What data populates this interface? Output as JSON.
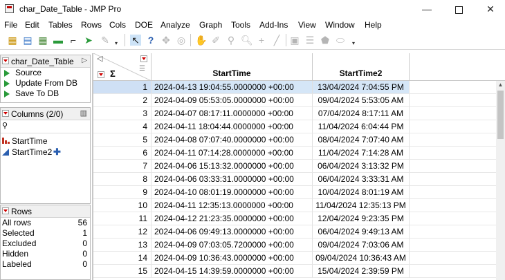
{
  "window": {
    "title": "char_Date_Table - JMP Pro",
    "minimize": "—",
    "close": "✕"
  },
  "menu": [
    "File",
    "Edit",
    "Tables",
    "Rows",
    "Cols",
    "DOE",
    "Analyze",
    "Graph",
    "Tools",
    "Add-Ins",
    "View",
    "Window",
    "Help"
  ],
  "table_panel": {
    "title": "char_Date_Table",
    "scripts": [
      "Source",
      "Update From DB",
      "Save To DB"
    ]
  },
  "columns_panel": {
    "title": "Columns (2/0)",
    "search_icon": "search-icon",
    "columns": [
      {
        "name": "StartTime",
        "icon": "continuous-bar-icon"
      },
      {
        "name": "StartTime2",
        "icon": "ordinal-triangle-icon"
      }
    ]
  },
  "rows_panel": {
    "title": "Rows",
    "stats": [
      {
        "label": "All rows",
        "value": "56"
      },
      {
        "label": "Selected",
        "value": "1"
      },
      {
        "label": "Excluded",
        "value": "0"
      },
      {
        "label": "Hidden",
        "value": "0"
      },
      {
        "label": "Labeled",
        "value": "0"
      }
    ]
  },
  "table": {
    "sigma": "Σ",
    "headers": [
      "StartTime",
      "StartTime2"
    ],
    "selected_row": 1,
    "rows": [
      {
        "n": "1",
        "a": "2024-04-13 19:04:55.0000000 +00:00",
        "b": "13/04/2024 7:04:55 PM"
      },
      {
        "n": "2",
        "a": "2024-04-09 05:53:05.0000000 +00:00",
        "b": "09/04/2024 5:53:05 AM"
      },
      {
        "n": "3",
        "a": "2024-04-07 08:17:11.0000000 +00:00",
        "b": "07/04/2024 8:17:11 AM"
      },
      {
        "n": "4",
        "a": "2024-04-11 18:04:44.0000000 +00:00",
        "b": "11/04/2024 6:04:44 PM"
      },
      {
        "n": "5",
        "a": "2024-04-08 07:07:40.0000000 +00:00",
        "b": "08/04/2024 7:07:40 AM"
      },
      {
        "n": "6",
        "a": "2024-04-11 07:14:28.0000000 +00:00",
        "b": "11/04/2024 7:14:28 AM"
      },
      {
        "n": "7",
        "a": "2024-04-06 15:13:32.0000000 +00:00",
        "b": "06/04/2024 3:13:32 PM"
      },
      {
        "n": "8",
        "a": "2024-04-06 03:33:31.0000000 +00:00",
        "b": "06/04/2024 3:33:31 AM"
      },
      {
        "n": "9",
        "a": "2024-04-10 08:01:19.0000000 +00:00",
        "b": "10/04/2024 8:01:19 AM"
      },
      {
        "n": "10",
        "a": "2024-04-11 12:35:13.0000000 +00:00",
        "b": "11/04/2024 12:35:13 PM"
      },
      {
        "n": "11",
        "a": "2024-04-12 21:23:35.0000000 +00:00",
        "b": "12/04/2024 9:23:35 PM"
      },
      {
        "n": "12",
        "a": "2024-04-06 09:49:13.0000000 +00:00",
        "b": "06/04/2024 9:49:13 AM"
      },
      {
        "n": "13",
        "a": "2024-04-09 07:03:05.7200000 +00:00",
        "b": "09/04/2024 7:03:06 AM"
      },
      {
        "n": "14",
        "a": "2024-04-09 10:36:43.0000000 +00:00",
        "b": "09/04/2024 10:36:43 AM"
      },
      {
        "n": "15",
        "a": "2024-04-15 14:39:59.0000000 +00:00",
        "b": "15/04/2024 2:39:59 PM"
      }
    ]
  },
  "colors": {
    "selection": "#d5e6f7",
    "red_triangle": "#d00000",
    "script_green": "#2a9a3a",
    "continuous_red": "#c03020",
    "ordinal_blue": "#2b5fb0"
  }
}
